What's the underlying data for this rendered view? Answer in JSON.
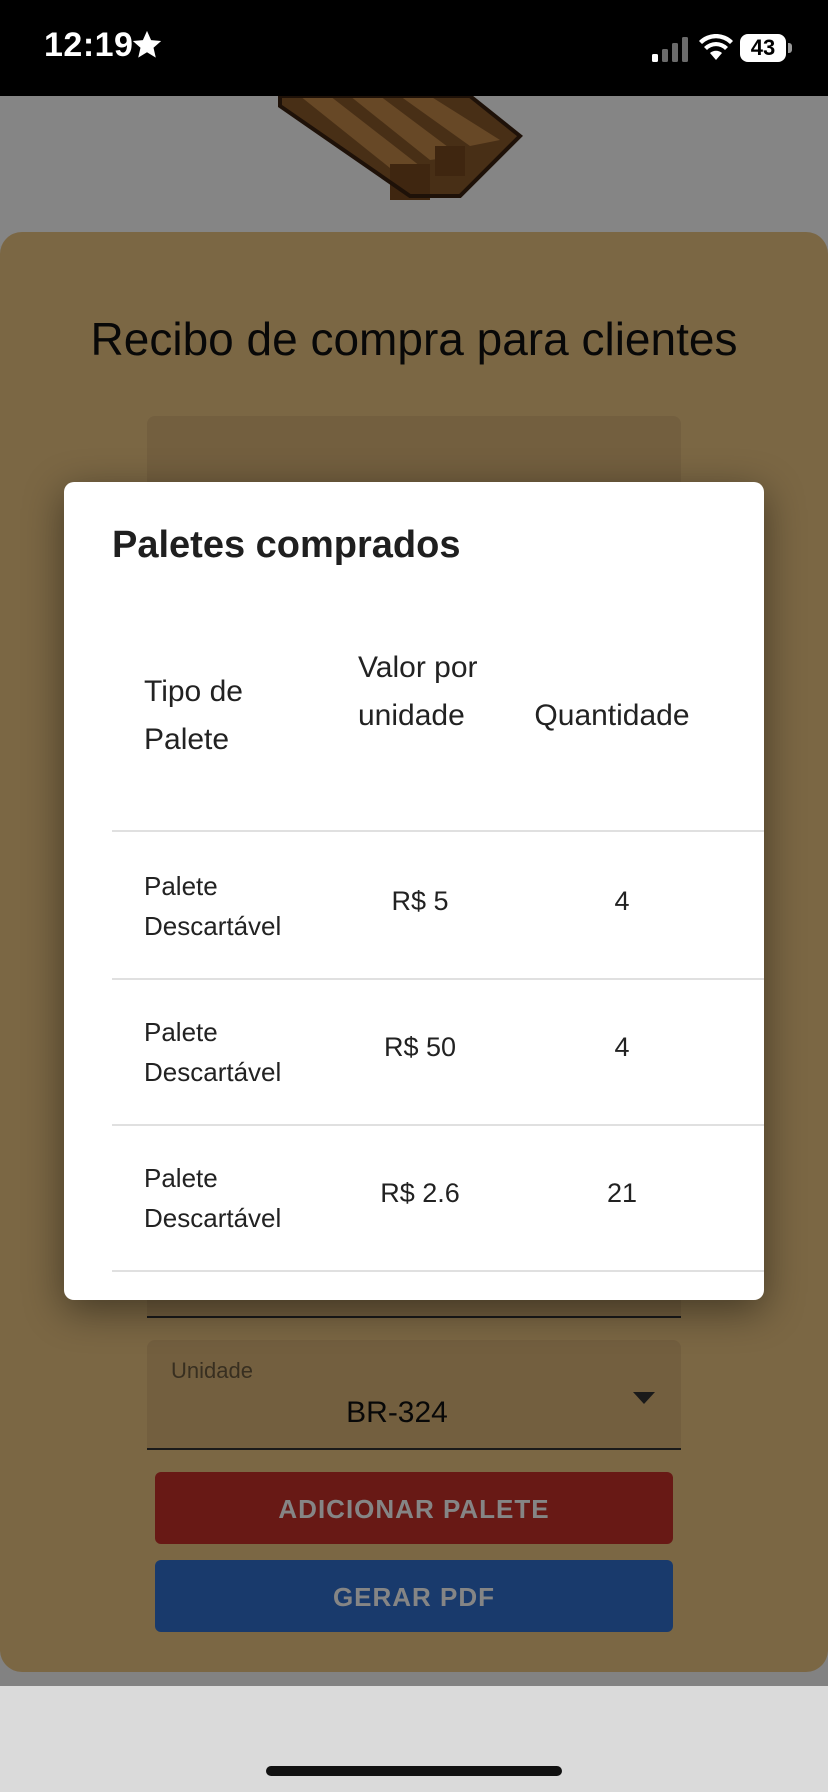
{
  "status_bar": {
    "time": "12:19",
    "battery": "43"
  },
  "form": {
    "title": "Recibo de compra para clientes",
    "unit_field": {
      "label": "Unidade",
      "value": "BR-324"
    },
    "add_button": "ADICIONAR PALETE",
    "pdf_button": "GERAR PDF"
  },
  "dialog": {
    "title": "Paletes comprados",
    "columns": {
      "type": "Tipo de Palete",
      "value": "Valor por unidade",
      "quantity": "Quantidade"
    },
    "rows": [
      {
        "type": "Palete Descartável",
        "value": "R$ 5",
        "quantity": "4"
      },
      {
        "type": "Palete Descartável",
        "value": "R$ 50",
        "quantity": "4"
      },
      {
        "type": "Palete Descartável",
        "value": "R$ 2.6",
        "quantity": "21"
      }
    ]
  },
  "colors": {
    "card": "#ecc583",
    "add_button": "#c8302a",
    "pdf_button": "#3170cf"
  }
}
